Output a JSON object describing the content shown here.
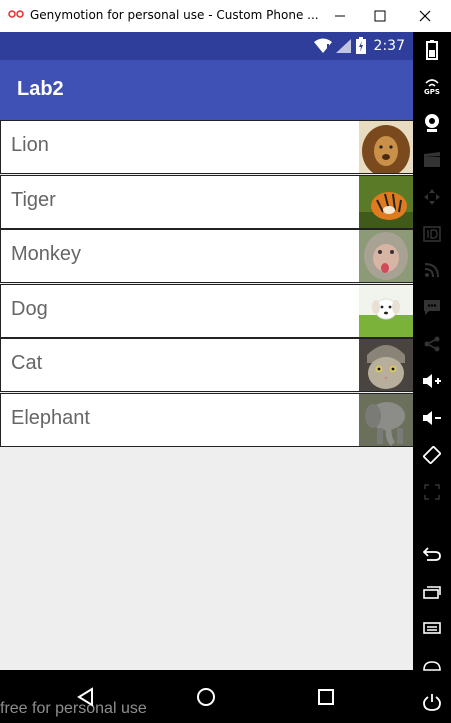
{
  "window": {
    "title": "Genymotion for personal use - Custom Phone ..."
  },
  "statusbar": {
    "time": "2:37"
  },
  "app": {
    "title": "Lab2"
  },
  "animals": [
    {
      "label": "Lion"
    },
    {
      "label": "Tiger"
    },
    {
      "label": "Monkey"
    },
    {
      "label": "Dog"
    },
    {
      "label": "Cat"
    },
    {
      "label": "Elephant"
    }
  ],
  "toolbar": {
    "gps_label": "GPS"
  },
  "watermark": "free for personal use",
  "colors": {
    "statusbar": "#2e3e9a",
    "appbar": "#3f51b5",
    "background": "#eeeeee"
  }
}
